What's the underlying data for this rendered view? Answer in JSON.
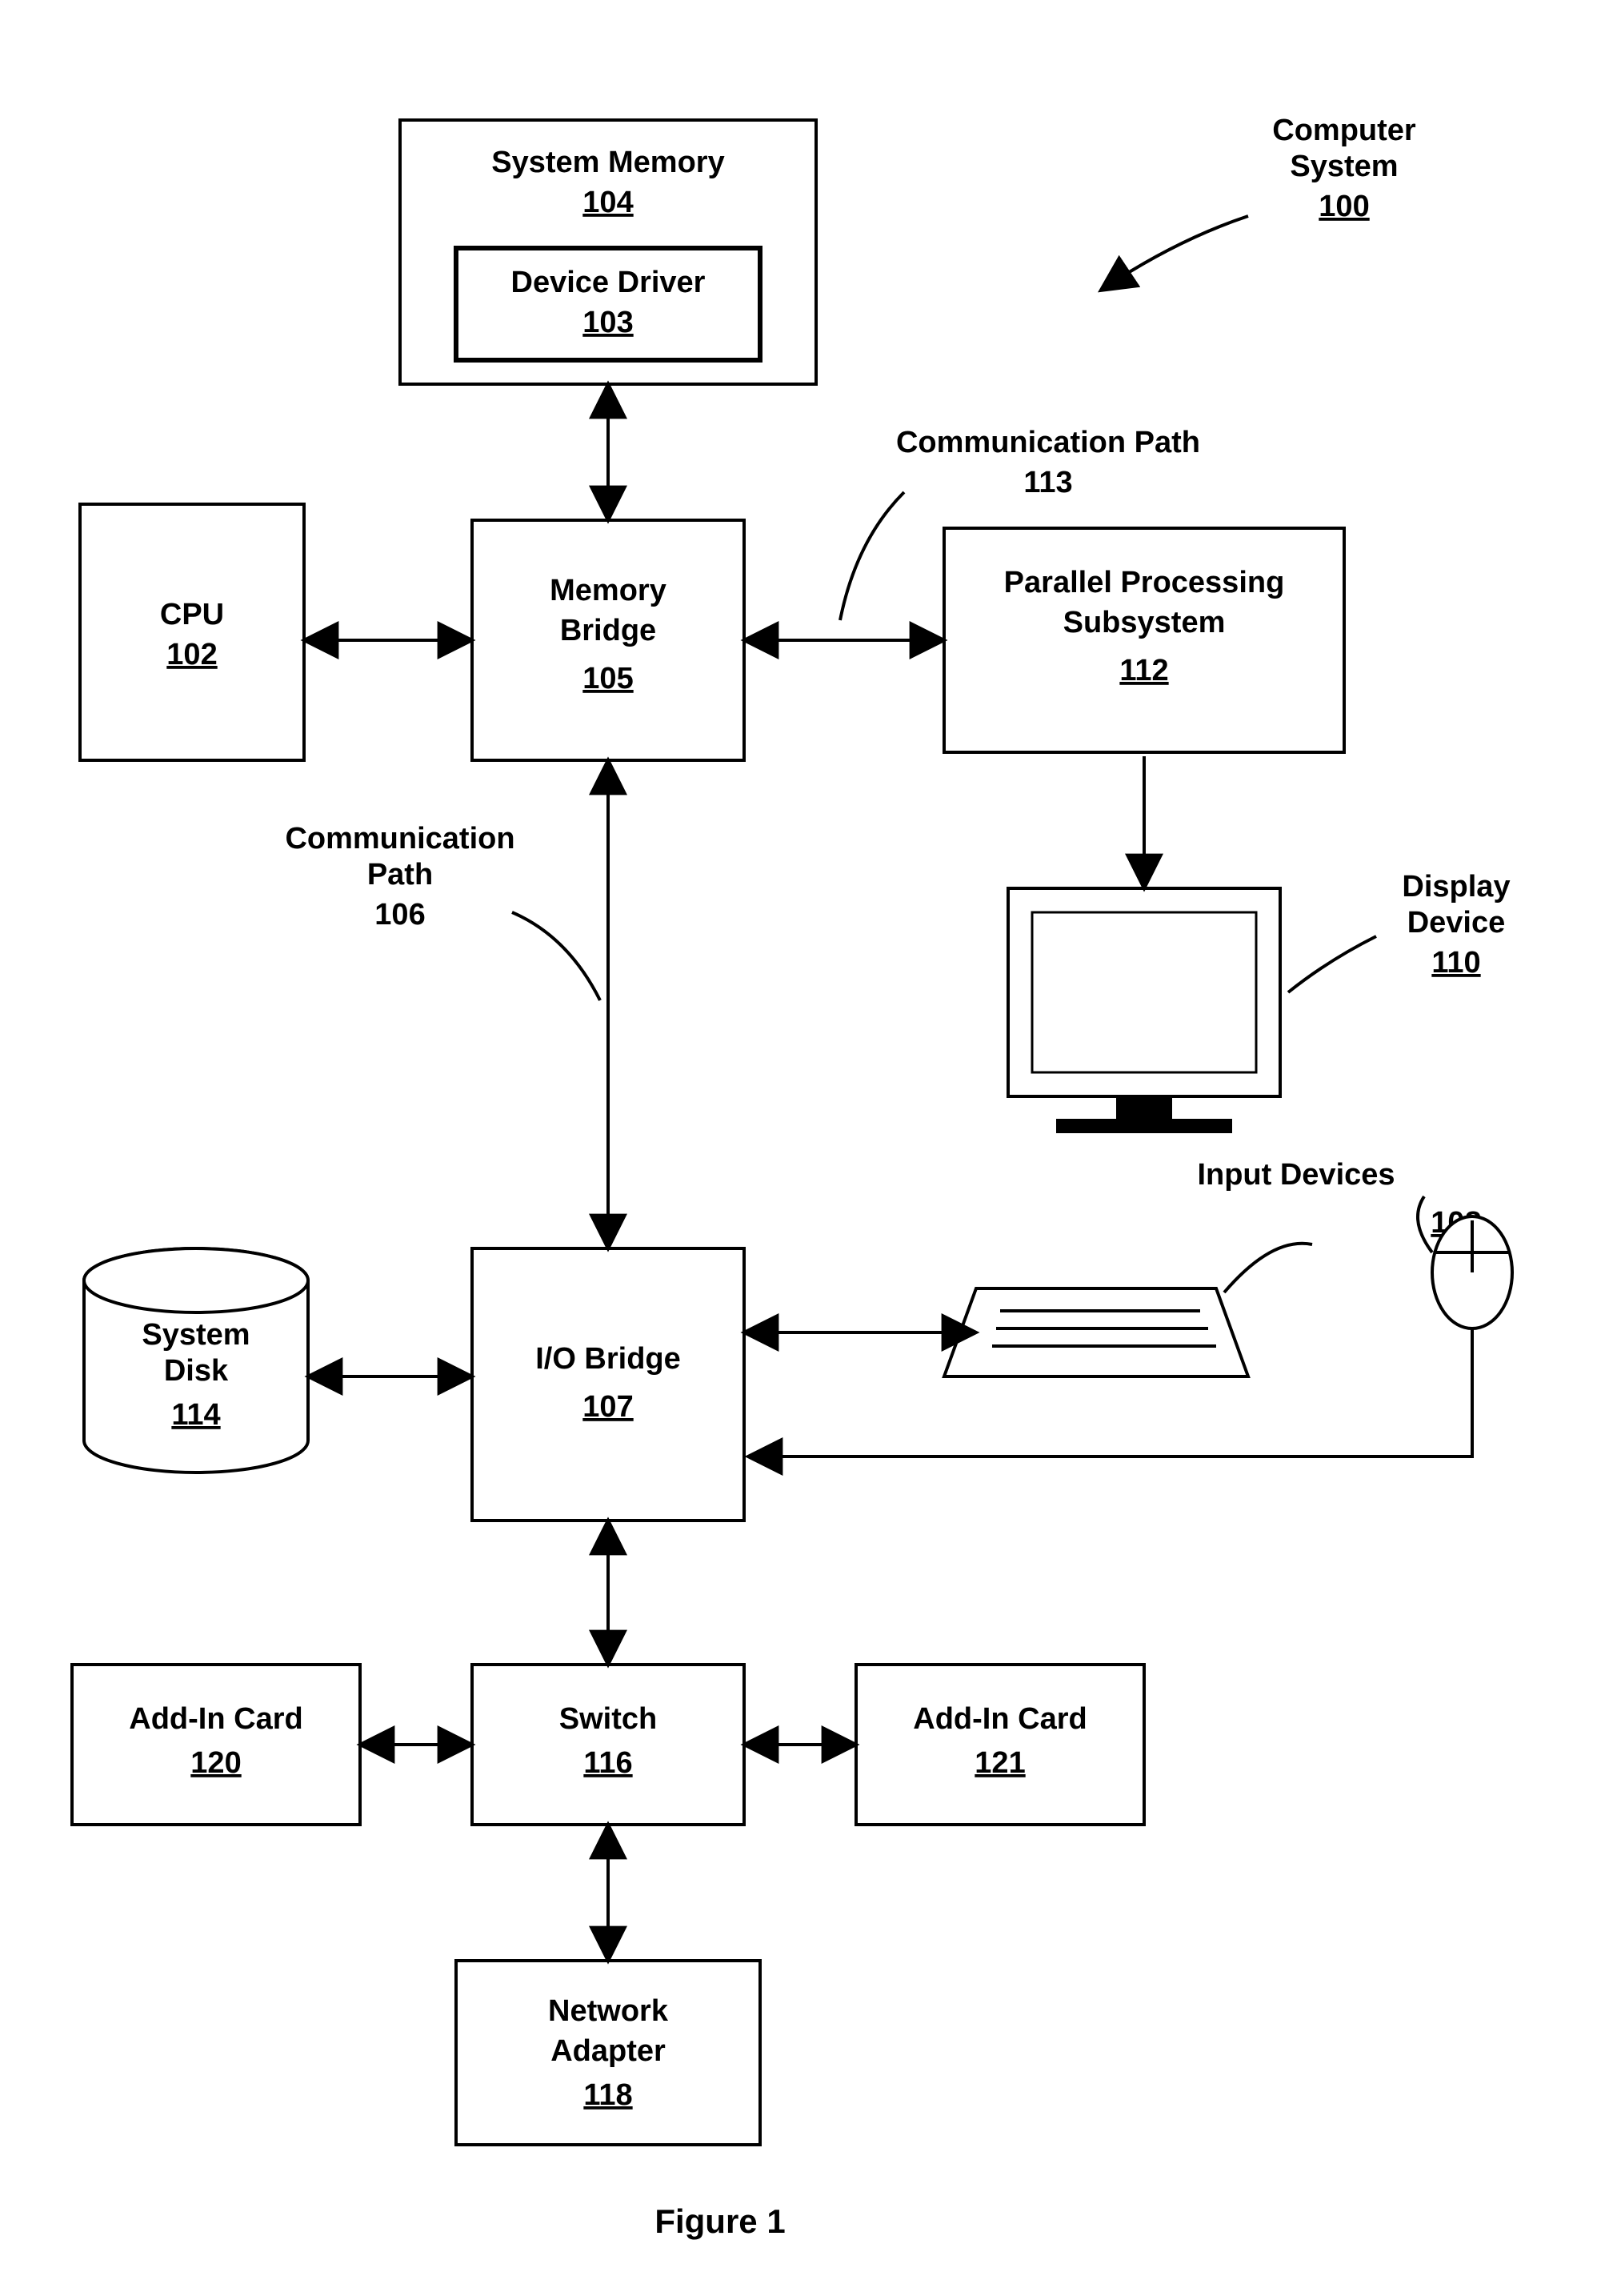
{
  "figure_caption": "Figure 1",
  "overall": {
    "label": "Computer\nSystem",
    "num": "100"
  },
  "boxes": {
    "system_memory": {
      "label": "System Memory",
      "num": "104"
    },
    "device_driver": {
      "label": "Device Driver",
      "num": "103"
    },
    "cpu": {
      "label": "CPU",
      "num": "102"
    },
    "memory_bridge": {
      "label": "Memory\nBridge",
      "num": "105"
    },
    "pps": {
      "label": "Parallel Processing\nSubsystem",
      "num": "112"
    },
    "io_bridge": {
      "label": "I/O Bridge",
      "num": "107"
    },
    "system_disk": {
      "label": "System\nDisk",
      "num": "114"
    },
    "switch": {
      "label": "Switch",
      "num": "116"
    },
    "addin_left": {
      "label": "Add-In Card",
      "num": "120"
    },
    "addin_right": {
      "label": "Add-In Card",
      "num": "121"
    },
    "net_adapter": {
      "label": "Network\nAdapter",
      "num": "118"
    },
    "display": {
      "label": "Display\nDevice",
      "num": "110"
    },
    "input_devices": {
      "label": "Input Devices",
      "num": "108"
    }
  },
  "paths": {
    "comm_113": {
      "label": "Communication Path",
      "num": "113"
    },
    "comm_106": {
      "label": "Communication\nPath",
      "num": "106"
    }
  }
}
